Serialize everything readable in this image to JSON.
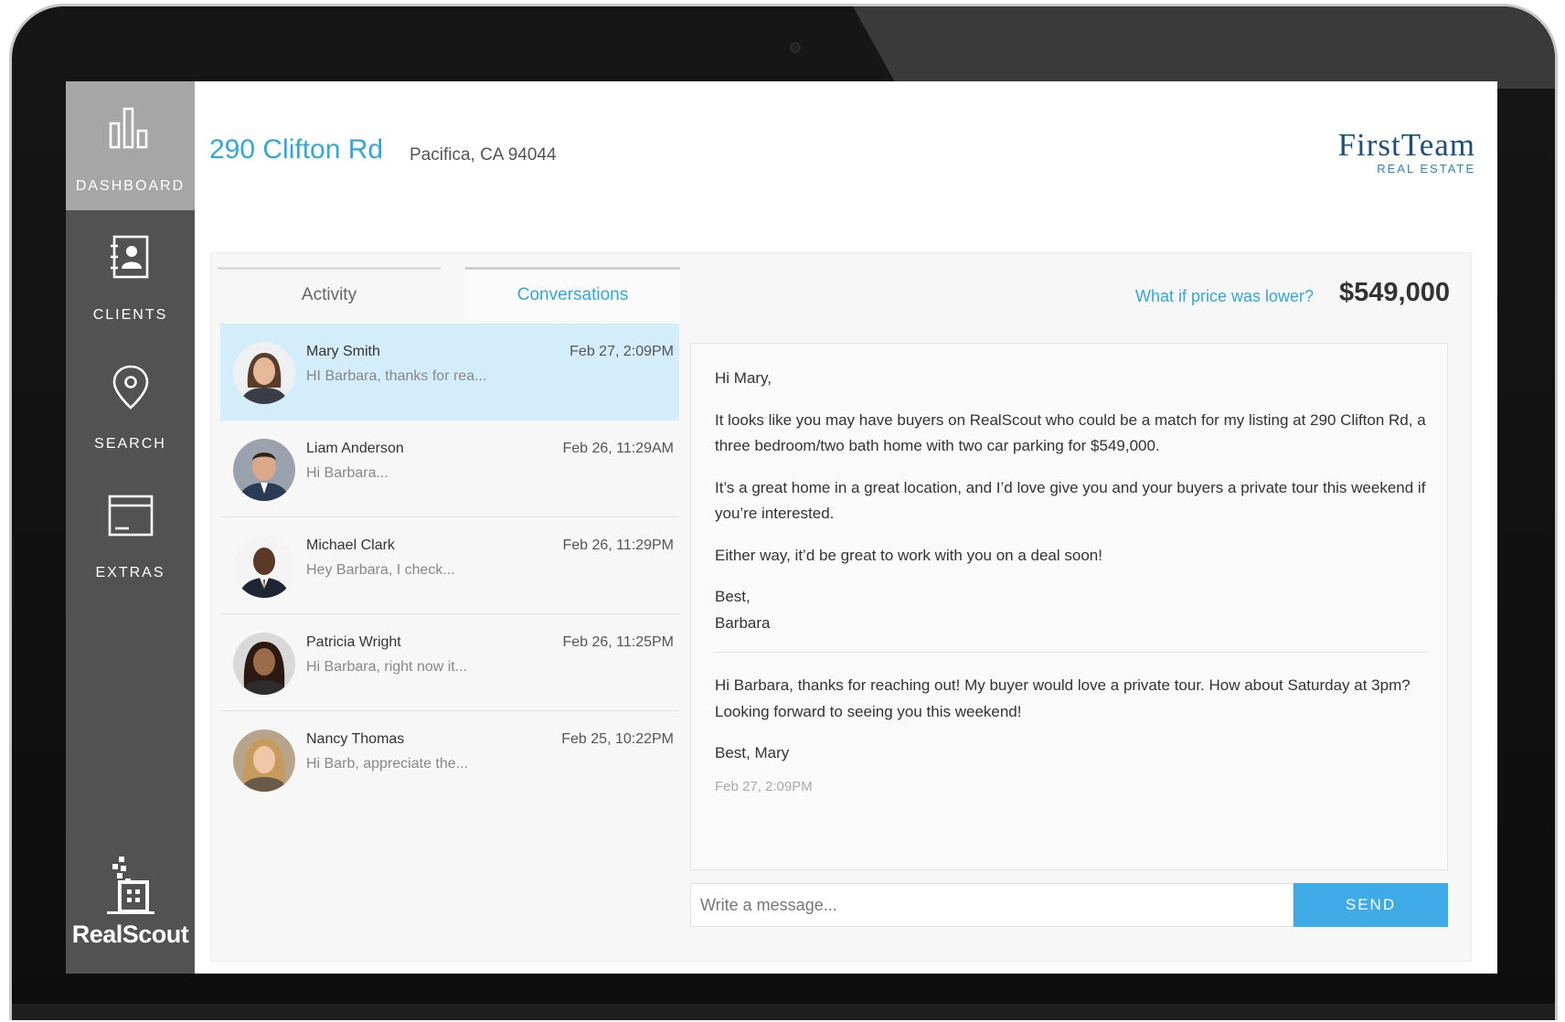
{
  "sidebar": {
    "items": [
      {
        "label": "DASHBOARD",
        "icon": "bar-chart-icon",
        "active": true
      },
      {
        "label": "CLIENTS",
        "icon": "contacts-book-icon",
        "active": false
      },
      {
        "label": "SEARCH",
        "icon": "map-pin-icon",
        "active": false
      },
      {
        "label": "EXTRAS",
        "icon": "window-icon",
        "active": false
      }
    ],
    "brand": "RealScout"
  },
  "header": {
    "address": "290 Clifton Rd",
    "city": "Pacifica, CA 94044",
    "logo": {
      "main": "FirstTeam",
      "sub": "REAL ESTATE"
    }
  },
  "tabs": [
    {
      "label": "Activity"
    },
    {
      "label": "Conversations"
    }
  ],
  "conversations": [
    {
      "name": "Mary Smith",
      "snippet": "HI Barbara, thanks for rea...",
      "date": "Feb 27, 2:09PM",
      "selected": true
    },
    {
      "name": "Liam Anderson",
      "snippet": "Hi Barbara...",
      "date": "Feb 26, 11:29AM"
    },
    {
      "name": "Michael Clark",
      "snippet": "Hey Barbara, I check...",
      "date": "Feb 26, 11:29PM"
    },
    {
      "name": "Patricia Wright",
      "snippet": "Hi Barbara, right now it...",
      "date": "Feb 26, 11:25PM"
    },
    {
      "name": "Nancy Thomas",
      "snippet": "Hi Barb, appreciate the...",
      "date": "Feb 25, 10:22PM"
    }
  ],
  "price": {
    "question": "What if price was lower?",
    "value": "$549,000"
  },
  "thread": {
    "outgoing": [
      "Hi Mary,",
      "It looks like you may have buyers on RealScout who could be a match for my listing at 290 Clifton Rd, a three bedroom/two bath home with two car parking for $549,000.",
      "It’s a great home in a great location, and I’d love give you and your buyers a private tour this weekend if you’re interested.",
      "Either way, it’d be great to work with you on a deal soon!",
      "Best,",
      "Barbara"
    ],
    "incoming": [
      "Hi Barbara, thanks for reaching out! My buyer would love a private tour. How about Saturday at 3pm? Looking forward to seeing you this weekend!",
      "Best, Mary"
    ],
    "timestamp": "Feb 27, 2:09PM"
  },
  "compose": {
    "placeholder": "Write a message...",
    "send_label": "SEND"
  },
  "colors": {
    "accent": "#33a7dc",
    "selected_row": "#d4edfb",
    "sidebar": "#525252",
    "sidebar_active": "#a6a6a6",
    "send": "#3eaae6"
  }
}
